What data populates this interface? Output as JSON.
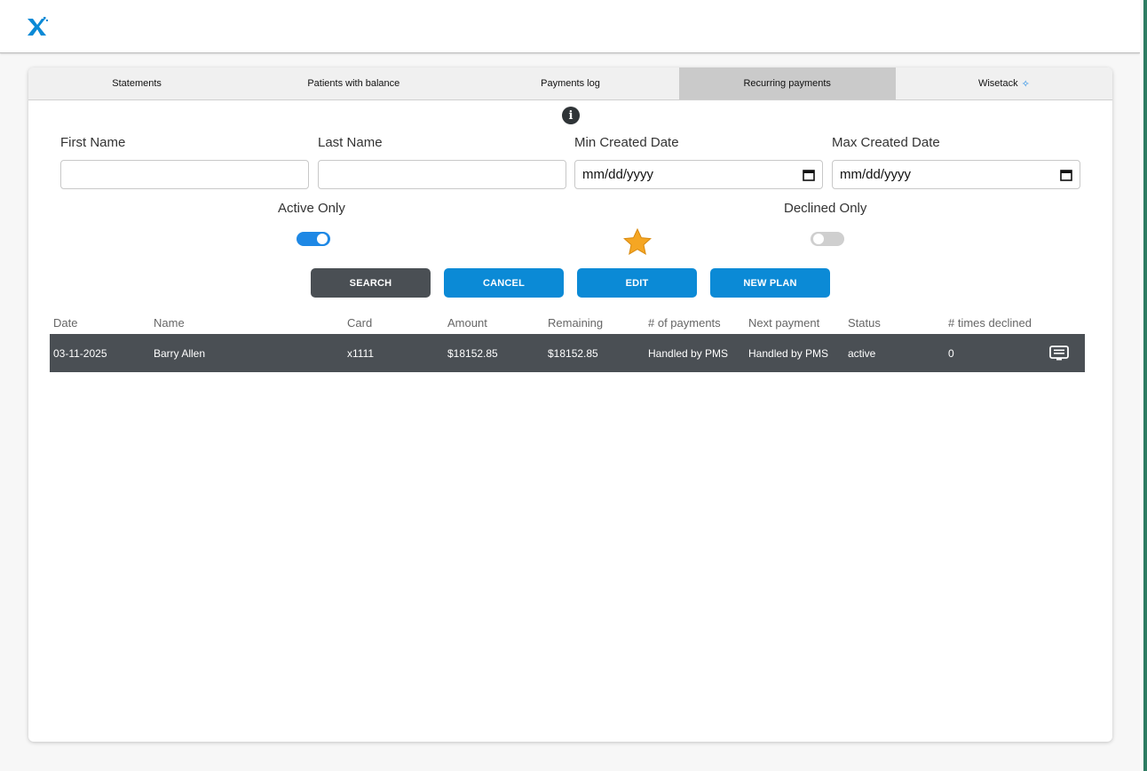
{
  "tabs": [
    {
      "label": "Statements"
    },
    {
      "label": "Patients with balance"
    },
    {
      "label": "Payments log"
    },
    {
      "label": "Recurring payments"
    },
    {
      "label": "Wisetack",
      "sparkle": "✧"
    }
  ],
  "filters": {
    "first_name": {
      "label": "First Name",
      "value": ""
    },
    "last_name": {
      "label": "Last Name",
      "value": ""
    },
    "min_created": {
      "label": "Min Created Date",
      "value": "mm/dd/yyyy"
    },
    "max_created": {
      "label": "Max Created Date",
      "value": "mm/dd/yyyy"
    },
    "active_only": {
      "label": "Active Only",
      "on": true
    },
    "declined_only": {
      "label": "Declined Only",
      "on": false
    }
  },
  "buttons": {
    "search": "SEARCH",
    "cancel": "CANCEL",
    "edit": "EDIT",
    "new_plan": "NEW PLAN"
  },
  "table": {
    "columns": [
      "Date",
      "Name",
      "Card",
      "Amount",
      "Remaining",
      "# of payments",
      "Next payment",
      "Status",
      "# times declined"
    ],
    "rows": [
      [
        "03-11-2025",
        "Barry Allen",
        "x1111",
        "$18152.85",
        "$18152.85",
        "Handled by PMS",
        "Handled by PMS",
        "active",
        "0"
      ]
    ]
  },
  "colors": {
    "brand_blue": "#0b8ad6",
    "dark_button": "#4a4f54",
    "active_tab": "#cacaca",
    "star": "#f5a623"
  },
  "icons": {
    "logo": "x-logo-icon",
    "info": "info-icon",
    "calendar": "calendar-icon",
    "star": "star-icon",
    "row_action": "message-icon"
  }
}
